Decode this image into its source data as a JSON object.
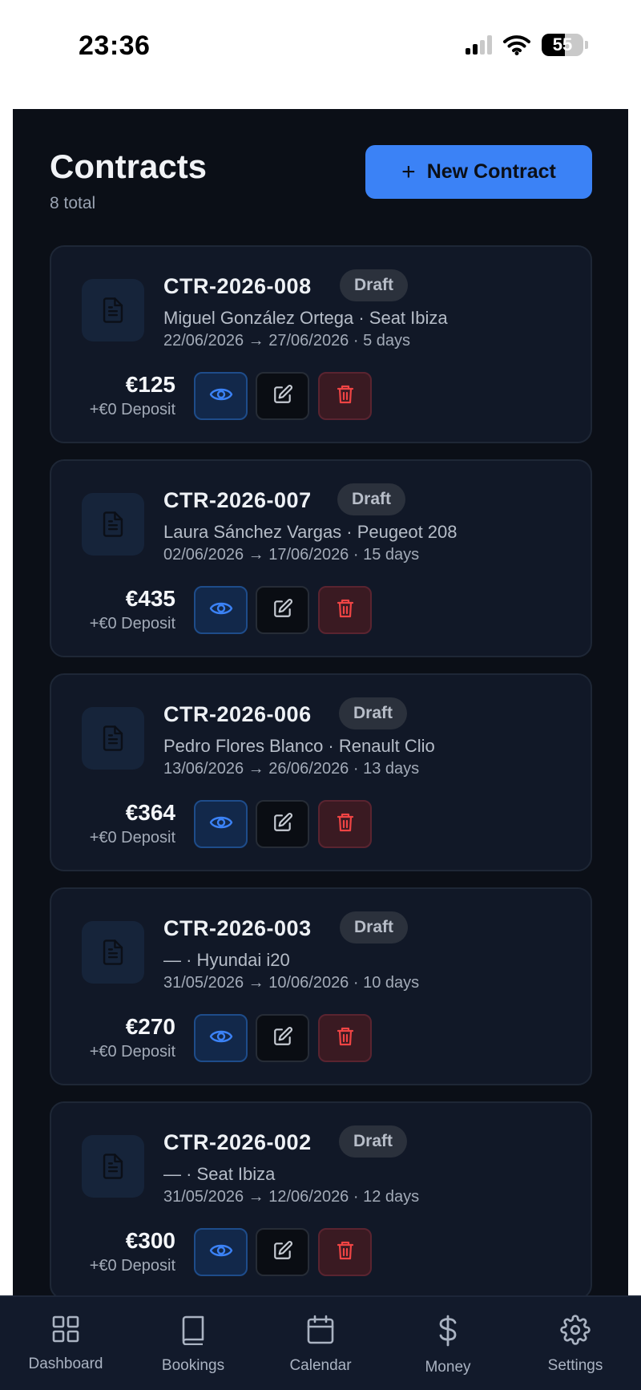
{
  "status": {
    "time": "23:36",
    "battery": "55",
    "battery_level": 0.55
  },
  "header": {
    "title": "Contracts",
    "subtitle": "8 total",
    "new_button_label": "New Contract"
  },
  "contracts": [
    {
      "id": "CTR-2026-008",
      "status": "Draft",
      "details": "Miguel González Ortega · Seat Ibiza",
      "dates": "22/06/2026 → 27/06/2026 · 5 days",
      "price": "€125",
      "deposit": "+€0 Deposit"
    },
    {
      "id": "CTR-2026-007",
      "status": "Draft",
      "details": "Laura Sánchez Vargas · Peugeot 208",
      "dates": "02/06/2026 → 17/06/2026 · 15 days",
      "price": "€435",
      "deposit": "+€0 Deposit"
    },
    {
      "id": "CTR-2026-006",
      "status": "Draft",
      "details": "Pedro Flores Blanco · Renault Clio",
      "dates": "13/06/2026 → 26/06/2026 · 13 days",
      "price": "€364",
      "deposit": "+€0 Deposit"
    },
    {
      "id": "CTR-2026-003",
      "status": "Draft",
      "details": "— · Hyundai i20",
      "dates": "31/05/2026 → 10/06/2026 · 10 days",
      "price": "€270",
      "deposit": "+€0 Deposit"
    },
    {
      "id": "CTR-2026-002",
      "status": "Draft",
      "details": "— · Seat Ibiza",
      "dates": "31/05/2026 → 12/06/2026 · 12 days",
      "price": "€300",
      "deposit": "+€0 Deposit"
    }
  ],
  "nav": {
    "items": [
      {
        "label": "Dashboard",
        "icon": "grid-icon"
      },
      {
        "label": "Bookings",
        "icon": "book-icon"
      },
      {
        "label": "Calendar",
        "icon": "calendar-icon"
      },
      {
        "label": "Money",
        "icon": "dollar-icon"
      },
      {
        "label": "Settings",
        "icon": "gear-icon"
      }
    ]
  },
  "colors": {
    "accent": "#3b82f6",
    "background": "#0b0f17",
    "card": "#111827",
    "danger": "#ef4444"
  }
}
